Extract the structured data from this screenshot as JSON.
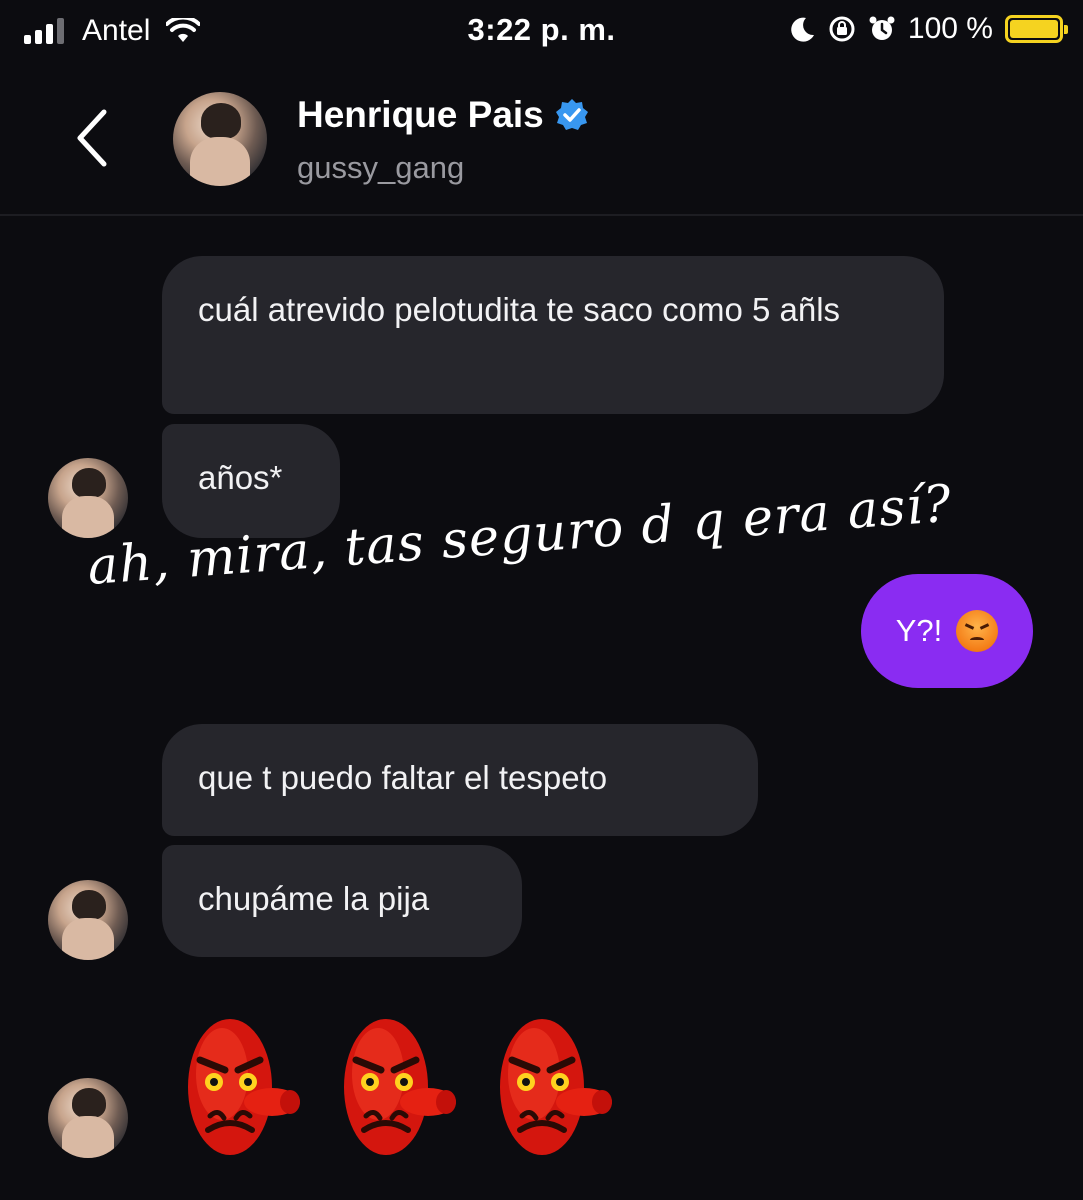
{
  "status_bar": {
    "carrier": "Antel",
    "time": "3:22 p. m.",
    "battery_percent": "100 %"
  },
  "header": {
    "contact_name": "Henrique Pais",
    "contact_handle": "gussy_gang",
    "verified": true
  },
  "messages": [
    {
      "from": "contact",
      "text": "cuál atrevido pelotudita te saco como 5 añls"
    },
    {
      "from": "contact",
      "text": "años*"
    },
    {
      "from": "me",
      "text": "Y?!",
      "emoji": "angry-face-icon"
    },
    {
      "from": "contact",
      "text": "que t puedo faltar el tespeto"
    },
    {
      "from": "contact",
      "text": "chupáme la pija"
    },
    {
      "from": "contact",
      "emojis": [
        "tengu-mask-icon",
        "tengu-mask-icon",
        "tengu-mask-icon"
      ]
    }
  ],
  "overlay_caption": "ah, mira, tas seguro d q era así?",
  "colors": {
    "background": "#0c0c10",
    "received_bubble": "#26262c",
    "sent_bubble": "#8a2cf2",
    "verified_badge": "#3897f0",
    "battery": "#f5d320"
  }
}
